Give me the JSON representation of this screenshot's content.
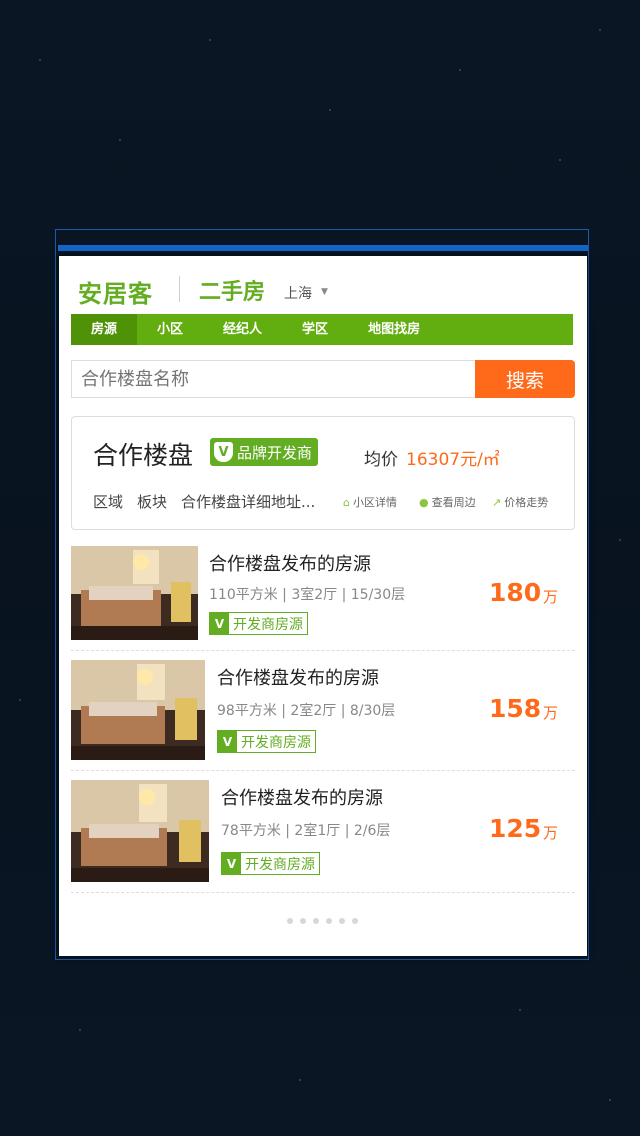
{
  "header": {
    "logo": "安居客",
    "section": "二手房",
    "city": "上海"
  },
  "nav": [
    "房源",
    "小区",
    "经纪人",
    "学区",
    "地图找房"
  ],
  "search": {
    "placeholder": "合作楼盘名称",
    "button": "搜索"
  },
  "info": {
    "name": "合作楼盘",
    "brand_badge": "品牌开发商",
    "price_label": "均价",
    "price_value": "16307元/㎡",
    "district": "区域",
    "block": "板块",
    "address": "合作楼盘详细地址...",
    "links": [
      {
        "label": "小区详情",
        "icon": "home-icon"
      },
      {
        "label": "查看周边",
        "icon": "pin-icon"
      },
      {
        "label": "价格走势",
        "icon": "trend-icon"
      }
    ]
  },
  "listings": [
    {
      "title": "合作楼盘发布的房源",
      "meta": "110平方米 | 3室2厅 | 15/30层",
      "badge": "开发商房源",
      "price": "180",
      "unit": "万"
    },
    {
      "title": "合作楼盘发布的房源",
      "meta": "98平方米 | 2室2厅 | 8/30层",
      "badge": "开发商房源",
      "price": "158",
      "unit": "万"
    },
    {
      "title": "合作楼盘发布的房源",
      "meta": "78平方米 | 2室1厅 | 2/6层",
      "badge": "开发商房源",
      "price": "125",
      "unit": "万"
    }
  ],
  "pagination_dots": 6,
  "colors": {
    "green": "#62ad22",
    "orange": "#ff6a1a",
    "blue": "#1166c8"
  }
}
